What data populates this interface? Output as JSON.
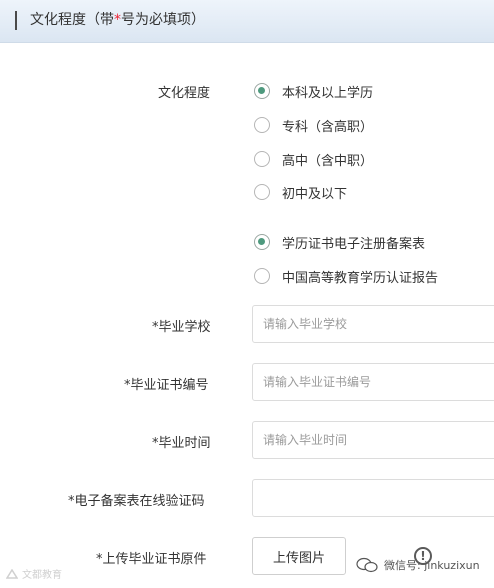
{
  "header": {
    "title_before": "文化程度（带",
    "asterisk": "*",
    "title_after": "号为必填项）"
  },
  "education": {
    "label": "文化程度",
    "options": [
      {
        "label": "本科及以上学历",
        "checked": true
      },
      {
        "label": "专科（含高职）",
        "checked": false
      },
      {
        "label": "高中（含中职）",
        "checked": false
      },
      {
        "label": "初中及以下",
        "checked": false
      }
    ]
  },
  "certificate_type": {
    "options": [
      {
        "label": "学历证书电子注册备案表",
        "checked": true
      },
      {
        "label": "中国高等教育学历认证报告",
        "checked": false
      }
    ]
  },
  "fields": {
    "school": {
      "label": "*毕业学校",
      "placeholder": "请输入毕业学校",
      "value": ""
    },
    "cert_no": {
      "label": "*毕业证书编号",
      "placeholder": "请输入毕业证书编号",
      "value": ""
    },
    "grad_time": {
      "label": "*毕业时间",
      "placeholder": "请输入毕业时间",
      "value": ""
    },
    "verify_code": {
      "label": "*电子备案表在线验证码",
      "placeholder": "",
      "value": ""
    },
    "upload": {
      "label": "*上传毕业证书原件",
      "button_label": "上传图片"
    }
  },
  "info_icon": {
    "glyph": "!",
    "icon": "info-icon"
  },
  "watermarks": {
    "left": "文都教育",
    "right": "微信号: jinkuzixun"
  }
}
